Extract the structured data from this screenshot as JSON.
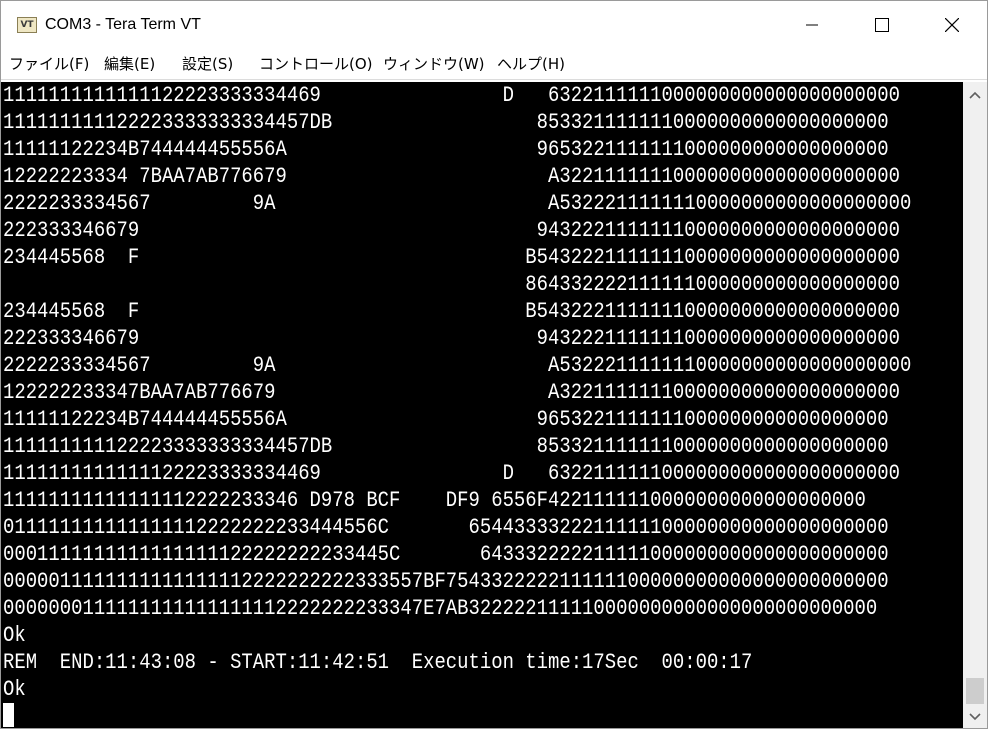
{
  "window": {
    "title": "COM3 - Tera Term VT",
    "icon_label": "VT",
    "controls": [
      "minimize-icon",
      "maximize-icon",
      "close-icon"
    ]
  },
  "menu": {
    "file": "ファイル(F)",
    "edit": "編集(E)",
    "setup": "設定(S)",
    "control": "コントロール(O)",
    "window": "ウィンドウ(W)",
    "help": "ヘルプ(H)"
  },
  "terminal": {
    "colors": {
      "background": "#000000",
      "foreground": "#ffffff"
    },
    "lines": [
      "1111111111111122223333334469                D   6322111111000000000000000000000",
      "111111111122223333333334457DB                  8533211111110000000000000000000",
      "11111122234B744444455556A                      9653221111111000000000000000000",
      "12222223334 7BAA7AB776679                       A322111111100000000000000000000",
      "2222233334567         9A                        A5322211111110000000000000000000",
      "222333346679                                   94322211111110000000000000000000",
      "234445568  F                                  B54322211111110000000000000000000",
      "                                              864332222111111000000000000000000",
      "234445568  F                                  B54322211111110000000000000000000",
      "222333346679                                   94322211111110000000000000000000",
      "2222233334567         9A                        A5322211111110000000000000000000",
      "122222233347BAA7AB776679                        A322111111100000000000000000000",
      "11111122234B744444455556A                      9653221111111000000000000000000",
      "111111111122223333333334457DB                  8533211111110000000000000000000",
      "1111111111111122223333334469                D   6322111111000000000000000000000",
      "11111111111111112222233346 D978 BCF    DF9 6556F4221111110000000000000000000",
      "011111111111111112222222233444556C       6544333322211111100000000000000000000",
      "0001111111111111111122222222233445C       643332222211111000000000000000000000",
      "0000011111111111111112222222222333557BF754332222211111100000000000000000000000",
      "0000000111111111111111112222222233347E7AB322222111110000000000000000000000000",
      "Ok",
      "REM  END:11:43:08 - START:11:42:51  Execution time:17Sec  00:00:17",
      "Ok"
    ]
  }
}
